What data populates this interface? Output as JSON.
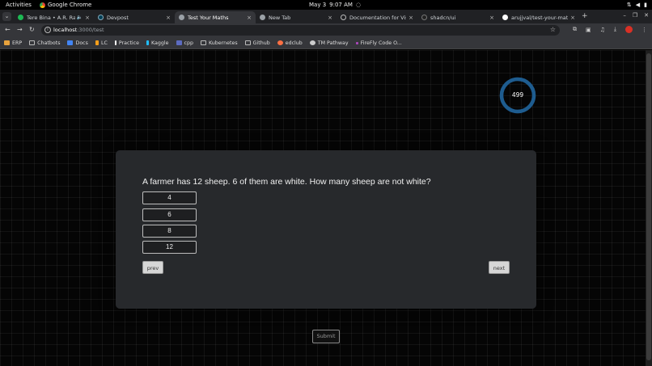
{
  "system_bar": {
    "activities": "Activities",
    "app_name": "Google Chrome",
    "date": "May 3",
    "time": "9:07 AM"
  },
  "tabs": [
    {
      "title": "Tere Bina • A.R. Rahm",
      "favicon_color": "#1db954",
      "active": false
    },
    {
      "title": "Devpost",
      "favicon_color": "#003e54",
      "active": false
    },
    {
      "title": "Test Your Maths",
      "favicon_color": "#9aa0a6",
      "active": true
    },
    {
      "title": "New Tab",
      "favicon_color": "#9aa0a6",
      "active": false
    },
    {
      "title": "Documentation for Visu",
      "favicon_color": "#9aa0a6",
      "active": false
    },
    {
      "title": "shadcn/ui",
      "favicon_color": "#222222",
      "active": false
    },
    {
      "title": "arujjval/test-your-math",
      "favicon_color": "#ffffff",
      "active": false
    }
  ],
  "address_bar": {
    "host": "localhost",
    "path": ":3000/test"
  },
  "bookmarks": [
    {
      "label": "ERP",
      "icon": "erp-icon",
      "color": "#e8a33d"
    },
    {
      "label": "Chatbots",
      "icon": "folder-icon",
      "color": ""
    },
    {
      "label": "Docs",
      "icon": "docs-icon",
      "color": "#4285f4"
    },
    {
      "label": "LC",
      "icon": "leetcode-icon",
      "color": "#f89f1b"
    },
    {
      "label": "Practice",
      "icon": "practice-icon",
      "color": "#ffffff"
    },
    {
      "label": "Kaggle",
      "icon": "kaggle-icon",
      "color": "#20beff"
    },
    {
      "label": "cpp",
      "icon": "cpp-icon",
      "color": "#5c6bc0"
    },
    {
      "label": "Kubernetes",
      "icon": "folder-icon",
      "color": ""
    },
    {
      "label": "Github",
      "icon": "folder-icon",
      "color": ""
    },
    {
      "label": "edclub",
      "icon": "edclub-icon",
      "color": "#ff7043"
    },
    {
      "label": "TM Pathway",
      "icon": "tm-icon",
      "color": "#cccccc"
    },
    {
      "label": "FireFly Code O...",
      "icon": "firefly-icon",
      "color": "#ab47bc"
    }
  ],
  "timer": {
    "value": "499",
    "ring_color": "#1e5c8f",
    "progress_fraction": 1.0
  },
  "quiz": {
    "question": "A farmer has 12 sheep. 6 of them are white. How many sheep are not white?",
    "options": [
      "4",
      "6",
      "8",
      "12"
    ],
    "prev_label": "prev",
    "next_label": "next",
    "submit_label": "Submit"
  }
}
